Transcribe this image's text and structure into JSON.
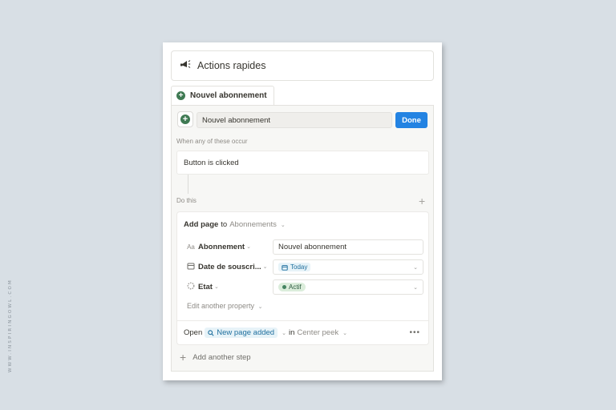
{
  "watermark": "WWW.INSPIRINGOWL.COM",
  "header": {
    "title": "Actions rapides",
    "icon": "megaphone-icon"
  },
  "tab": {
    "label": "Nouvel abonnement",
    "icon": "plus-circle-icon"
  },
  "editor": {
    "name_value": "Nouvel abonnement",
    "done_label": "Done",
    "trigger_label": "When any of these occur",
    "trigger_text": "Button is clicked",
    "do_label": "Do this",
    "action": {
      "verb": "Add page",
      "connector": "to",
      "database": "Abonnements",
      "properties": [
        {
          "icon": "Aa",
          "name": "Abonnement",
          "value": "Nouvel abonnement"
        },
        {
          "icon": "calendar-icon",
          "name": "Date de souscri...",
          "value": "Today"
        },
        {
          "icon": "status-icon",
          "name": "Etat",
          "value": "Actif"
        }
      ],
      "edit_another": "Edit another property",
      "open": {
        "label": "Open",
        "target": "New page added",
        "in_label": "in",
        "mode": "Center peek",
        "more": "•••"
      }
    },
    "add_step": "Add another step"
  },
  "colors": {
    "accent": "#2383e2",
    "green": "#3f7a53"
  }
}
